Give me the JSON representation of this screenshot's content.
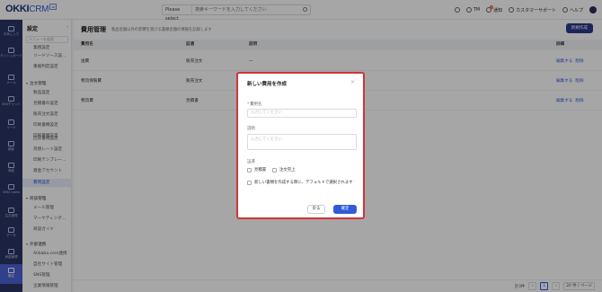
{
  "app": {
    "logo_main": "OKKI",
    "logo_sub": "CRM",
    "logo_badge": "AI",
    "search_select": "Please select",
    "search_placeholder": "検索キーワードを入力してください",
    "user_initials": "TM",
    "notifications_label": "通知",
    "notifications_count": "3",
    "support_label": "カスタマーサポート",
    "help_label": "ヘルプ"
  },
  "rail": [
    {
      "label": "お気に入り",
      "icon": "star-icon"
    },
    {
      "label": "ダッシュボード",
      "icon": "dashboard-icon"
    },
    {
      "label": "メール",
      "icon": "mail-icon"
    },
    {
      "label": "SNSチャット",
      "icon": "chat-icon"
    },
    {
      "label": "リード",
      "icon": "lead-icon"
    },
    {
      "label": "顧客",
      "icon": "customer-icon"
    },
    {
      "label": "商談",
      "icon": "deal-icon"
    },
    {
      "label": "OKKI Leads",
      "icon": "leads-icon"
    },
    {
      "label": "注文管理",
      "icon": "order-icon"
    },
    {
      "label": "データ",
      "icon": "data-icon"
    },
    {
      "label": "承認管理",
      "icon": "approval-icon"
    },
    {
      "label": "設定",
      "icon": "settings-icon"
    }
  ],
  "subnav": {
    "title": "設定",
    "search_placeholder": "メニューを検索",
    "items": [
      {
        "label": "業務設定",
        "type": "item"
      },
      {
        "label": "リードソース設...",
        "type": "item"
      },
      {
        "label": "重複判定設定",
        "type": "item"
      },
      {
        "label": "注文管理",
        "type": "group"
      },
      {
        "label": "製品設定",
        "type": "item"
      },
      {
        "label": "見積書の設定",
        "type": "item"
      },
      {
        "label": "販売注文設定",
        "type": "item"
      },
      {
        "label": "印刷書類設定",
        "type": "item"
      },
      {
        "label": "印刷書類設定",
        "type": "item"
      },
      {
        "label": "回収書類設定",
        "type": "item",
        "active": true
      },
      {
        "label": "為替レート設定",
        "type": "item"
      },
      {
        "label": "印刷テンプレー...",
        "type": "item"
      },
      {
        "label": "資金アカウント",
        "type": "item"
      },
      {
        "label": "費用設定",
        "type": "item"
      },
      {
        "label": "商談管理",
        "type": "group"
      },
      {
        "label": "メール管理",
        "type": "item"
      },
      {
        "label": "マーケティング...",
        "type": "item"
      },
      {
        "label": "商談ガイド",
        "type": "item"
      },
      {
        "label": "外部連携",
        "type": "group"
      },
      {
        "label": "Alibaba.com連携",
        "type": "item"
      },
      {
        "label": "自社サイト管理",
        "type": "item"
      },
      {
        "label": "SNS管理",
        "type": "item"
      },
      {
        "label": "企業情報管理",
        "type": "item"
      }
    ]
  },
  "main": {
    "title": "費用管理",
    "description": "製品金額以外の影響を受ける書類金額の情報を記録します",
    "new_button": "新規作成",
    "columns": [
      "費用名",
      "証憑",
      "説明",
      "詳細"
    ],
    "rows": [
      {
        "name": "送費",
        "voucher": "販売注文",
        "desc": "—",
        "edit": "編集する",
        "del": "削除"
      },
      {
        "name": "物流保険費",
        "voucher": "販売注文",
        "desc": "—",
        "edit": "編集する",
        "del": "削除"
      },
      {
        "name": "物流費",
        "voucher": "見積書",
        "desc": "—",
        "edit": "編集する",
        "del": "削除"
      }
    ],
    "footer_total": "計3件",
    "footer_page": "1",
    "footer_size": "20 件 / ページ"
  },
  "modal": {
    "title": "新しい費用を作成",
    "name_label": "費用名",
    "name_placeholder": "入力してください",
    "desc_label": "説明",
    "desc_placeholder": "入力してください",
    "voucher_label": "証憑",
    "option_quote": "見積書",
    "option_order": "注文完上",
    "default_option": "新しい書類を作成する際に、デフォルトで選択されます",
    "back_button": "戻る",
    "confirm_button": "確定"
  }
}
